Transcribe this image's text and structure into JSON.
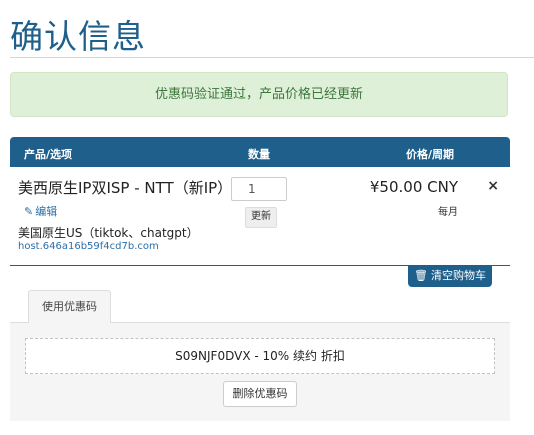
{
  "page": {
    "title": "确认信息"
  },
  "alert": {
    "message": "优惠码验证通过，产品价格已经更新"
  },
  "cart": {
    "headers": {
      "product": "产品/选项",
      "quantity": "数量",
      "price": "价格/周期"
    },
    "item": {
      "name": "美西原生IP双ISP - NTT（新IP）",
      "edit_label": "编辑",
      "description": "美国原生US（tiktok、chatgpt）",
      "hostname": "host.646a16b59f4cd7b.com",
      "quantity": "1",
      "update_label": "更新",
      "price": "¥50.00 CNY",
      "period": "每月",
      "remove_symbol": "×"
    },
    "clear_label": "清空购物车"
  },
  "promo": {
    "tab_label": "使用优惠码",
    "applied_code": "S09NJF0DVX - 10% 续约 折扣",
    "remove_label": "删除优惠码"
  },
  "colors": {
    "brand": "#1f5f8b",
    "success_bg": "#dff0d8",
    "success_text": "#3c763d"
  },
  "icons": {
    "edit": "pencil-icon",
    "clear": "trash-icon",
    "remove": "close-icon"
  }
}
